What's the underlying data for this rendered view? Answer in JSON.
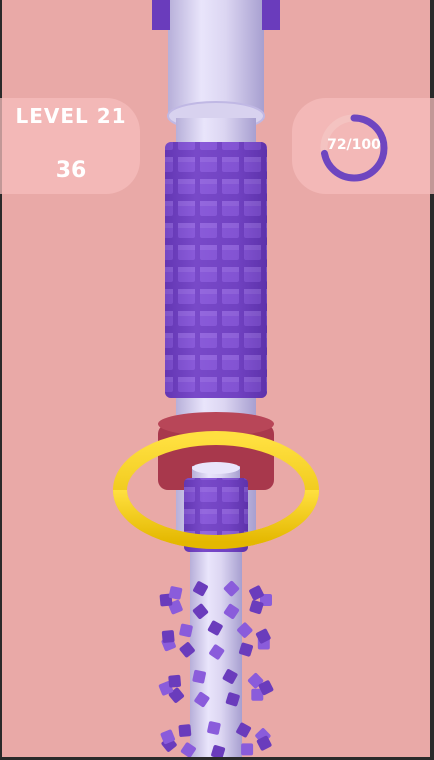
{
  "hud": {
    "level_label": "LEVEL 21",
    "score": "36",
    "progress_text": "72/100",
    "progress_fraction": 0.72
  },
  "colors": {
    "background": "#e9a9a7",
    "pole": "#dcd6f2",
    "block": "#7a49c9",
    "ring": "#f2cd0a",
    "collar": "#a8384c",
    "progress_track": "#f4c3c1",
    "progress_fill": "#6e46c0"
  },
  "icons": [
    "progress-ring-icon"
  ]
}
